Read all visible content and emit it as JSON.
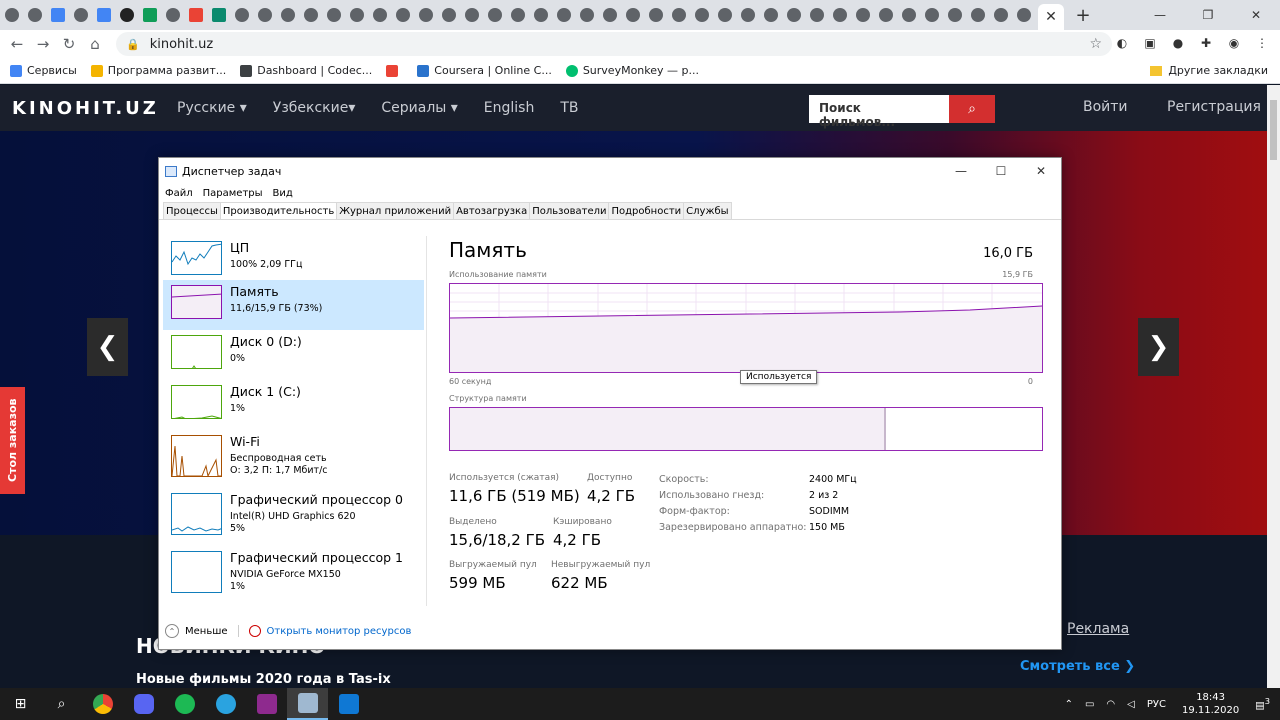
{
  "browser": {
    "url": "kinohit.uz",
    "bookmarks": [
      {
        "label": "Сервисы",
        "color": "#4285f4"
      },
      {
        "label": "Программа развит...",
        "color": "#f4b400"
      },
      {
        "label": "Dashboard | Codec...",
        "color": "#3c4043"
      },
      {
        "label": "",
        "color": "#ea4335"
      },
      {
        "label": "Coursera | Online C...",
        "color": "#2a73cc"
      },
      {
        "label": "SurveyMonkey — р...",
        "color": "#00bf6f"
      }
    ],
    "other_bookmarks": "Другие закладки"
  },
  "site": {
    "logo": "KINOHIT.UZ",
    "nav": [
      "Русские ▾",
      "Узбекские▾",
      "Сериалы ▾",
      "English",
      "ТВ"
    ],
    "search_placeholder": "Поиск фильмов...",
    "login": "Войти",
    "register": "Регистрация",
    "side_tab": "Стол заказов",
    "novinki": "НОВИНКИ КИНО",
    "novinki_sub": "Новые фильмы 2020 года в Tas-ix",
    "smotret": "Смотреть все ❯",
    "reklama": "Реклама"
  },
  "taskmanager": {
    "title": "Диспетчер задач",
    "menu": [
      "Файл",
      "Параметры",
      "Вид"
    ],
    "tabs": [
      "Процессы",
      "Производительность",
      "Журнал приложений",
      "Автозагрузка",
      "Пользователи",
      "Подробности",
      "Службы"
    ],
    "resources": [
      {
        "name": "ЦП",
        "line1": "100%  2,09 ГГц",
        "line2": "",
        "color": "#117dbb"
      },
      {
        "name": "Память",
        "line1": "11,6/15,9 ГБ (73%)",
        "line2": "",
        "color": "#8b12ae"
      },
      {
        "name": "Диск 0 (D:)",
        "line1": "0%",
        "line2": "",
        "color": "#4da60c"
      },
      {
        "name": "Диск 1 (C:)",
        "line1": "1%",
        "line2": "",
        "color": "#4da60c"
      },
      {
        "name": "Wi-Fi",
        "line1": "Беспроводная сеть",
        "line2": "О: 3,2  П: 1,7 Мбит/с",
        "color": "#a74f01"
      },
      {
        "name": "Графический процессор 0",
        "line1": "Intel(R) UHD Graphics 620",
        "line2": "5%",
        "color": "#117dbb"
      },
      {
        "name": "Графический процессор 1",
        "line1": "NVIDIA GeForce MX150",
        "line2": "1%",
        "color": "#117dbb"
      }
    ],
    "memory": {
      "title": "Память",
      "total": "16,0 ГБ",
      "usage_label": "Использование памяти",
      "usage_max": "15,9 ГБ",
      "time_left": "60 секунд",
      "time_right": "0",
      "tooltip": "Используется",
      "structure_label": "Структура памяти",
      "stats": [
        {
          "label": "Используется (сжатая)",
          "value": "11,6 ГБ (519 МБ)"
        },
        {
          "label": "Доступно",
          "value": "4,2 ГБ"
        },
        {
          "label": "Выделено",
          "value": "15,6/18,2 ГБ"
        },
        {
          "label": "Кэшировано",
          "value": "4,2 ГБ"
        },
        {
          "label": "Выгружаемый пул",
          "value": "599 МБ"
        },
        {
          "label": "Невыгружаемый пул",
          "value": "622 МБ"
        }
      ],
      "details": [
        {
          "label": "Скорость:",
          "value": "2400 МГц"
        },
        {
          "label": "Использовано гнезд:",
          "value": "2 из 2"
        },
        {
          "label": "Форм-фактор:",
          "value": "SODIMM"
        },
        {
          "label": "Зарезервировано аппаратно:",
          "value": "150 МБ"
        }
      ]
    },
    "footer": {
      "less": "Меньше",
      "monitor": "Открыть монитор ресурсов"
    }
  },
  "taskbar": {
    "lang": "РУС",
    "time": "18:43",
    "date": "19.11.2020",
    "notif_count": "3"
  }
}
